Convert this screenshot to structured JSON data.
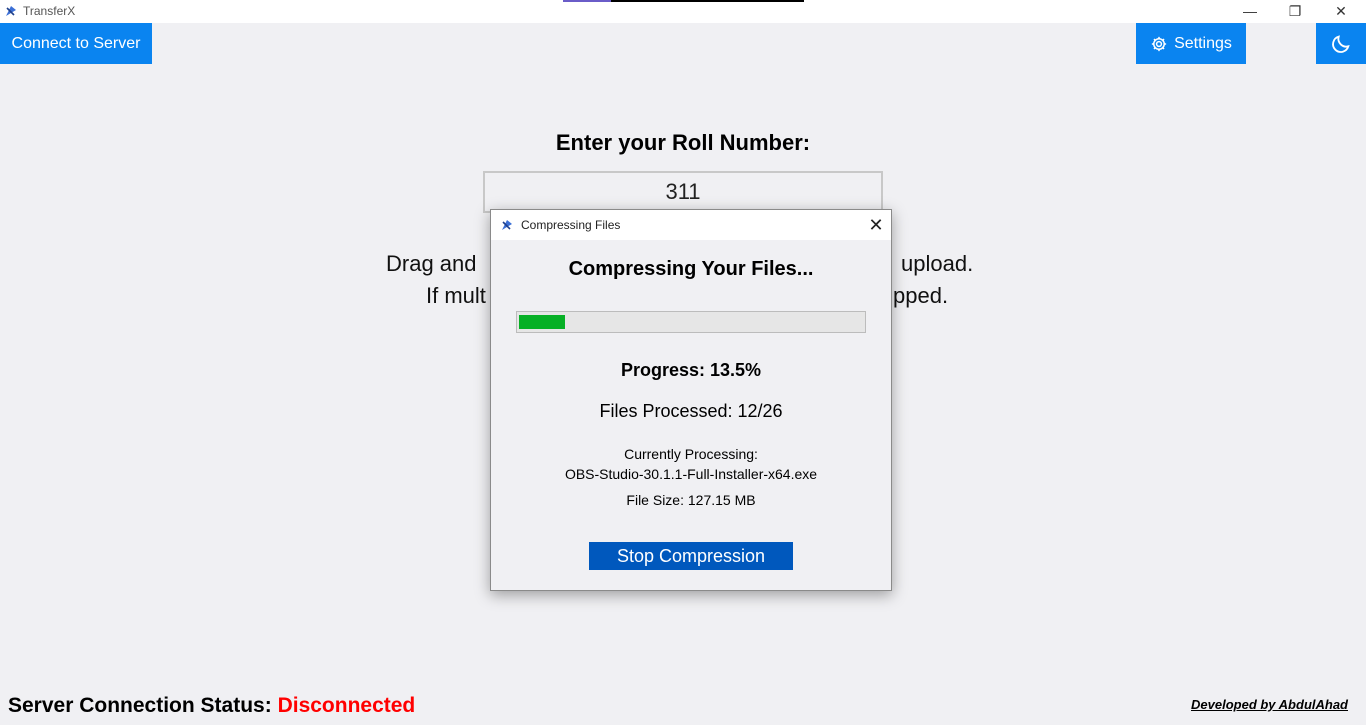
{
  "window": {
    "title": "TransferX",
    "minimize_glyph": "—",
    "maximize_glyph": "❐",
    "close_glyph": "✕"
  },
  "toolbar": {
    "connect_label": "Connect to Server",
    "settings_label": "Settings",
    "settings_icon": "gear-icon",
    "theme_icon": "moon-icon"
  },
  "main": {
    "roll_label": "Enter your Roll Number:",
    "roll_value": "311",
    "drag_line1_left": "Drag and",
    "drag_line1_right": "upload.",
    "drag_line2_left": "If mult",
    "drag_line2_right": "pped."
  },
  "dialog": {
    "title": "Compressing Files",
    "close_glyph": "✕",
    "heading": "Compressing Your Files...",
    "progress_percent": 13.5,
    "progress_text": "Progress: 13.5%",
    "files_processed": "Files Processed: 12/26",
    "current_label": "Currently Processing:",
    "current_file": "OBS-Studio-30.1.1-Full-Installer-x64.exe",
    "file_size": "File Size: 127.15 MB",
    "stop_label": "Stop Compression"
  },
  "footer": {
    "status_label": "Server Connection Status: ",
    "status_value": "Disconnected",
    "developer": "Developed by AbdulAhad"
  },
  "colors": {
    "accent": "#0a84f0",
    "stop_button": "#0058bd",
    "progress": "#06b025",
    "disconnected": "#ff0000",
    "background": "#f0f0f3"
  }
}
